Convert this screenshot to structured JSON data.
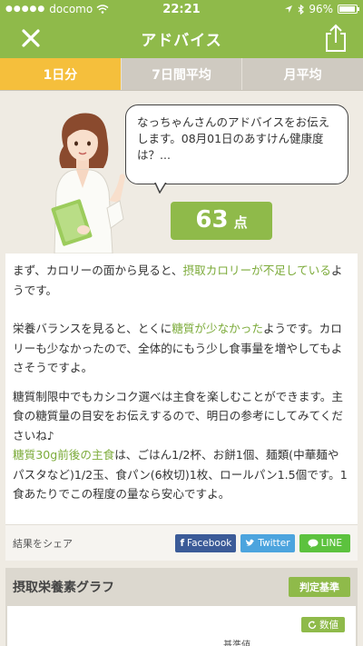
{
  "status": {
    "carrier": "docomo",
    "time": "22:21",
    "battery": "96%"
  },
  "header": {
    "title": "アドバイス",
    "close_icon": "close-icon",
    "share_icon": "share-icon"
  },
  "tabs": [
    {
      "label": "1日分",
      "active": true
    },
    {
      "label": "7日間平均",
      "active": false
    },
    {
      "label": "月平均",
      "active": false
    }
  ],
  "advisor": {
    "bubble": "なっちゃんさんのアドバイスをお伝えします。08月01日のあすけん健康度は？...",
    "score": "63",
    "score_unit": "点"
  },
  "advice": {
    "p1_pre": "まず、カロリーの面から見ると、",
    "p1_hl": "摂取カロリーが不足している",
    "p1_post": "ようです。",
    "p2_pre": "栄養バランスを見ると、とくに",
    "p2_hl": "糖質が少なかった",
    "p2_post": "ようです。カロリーも少なかったので、全体的にもう少し食事量を増やしてもよさそうですよ。",
    "p3": "糖質制限中でもカシコク選べは主食を楽しむことができます。主食の糖質量の目安をお伝えするので、明日の参考にしてみてくださいね♪",
    "p4_hl": "糖質30g前後の主食",
    "p4_post": "は、ごはん1/2杯、お餅1個、麺類(中華麺やパスタなど)1/2玉、食パン(6枚切)1枚、ロールパン1.5個です。1食あたりでこの程度の量なら安心ですよ。"
  },
  "share": {
    "label": "結果をシェア",
    "facebook": "Facebook",
    "twitter": "Twitter",
    "line": "LINE"
  },
  "graph": {
    "title": "摂取栄養素グラフ",
    "criteria_button": "判定基準",
    "values_button": "数値",
    "base_label": "基準値"
  },
  "colors": {
    "brand_green": "#8fba4a",
    "active_tab": "#f5bf3c",
    "highlight": "#7cab3a"
  }
}
